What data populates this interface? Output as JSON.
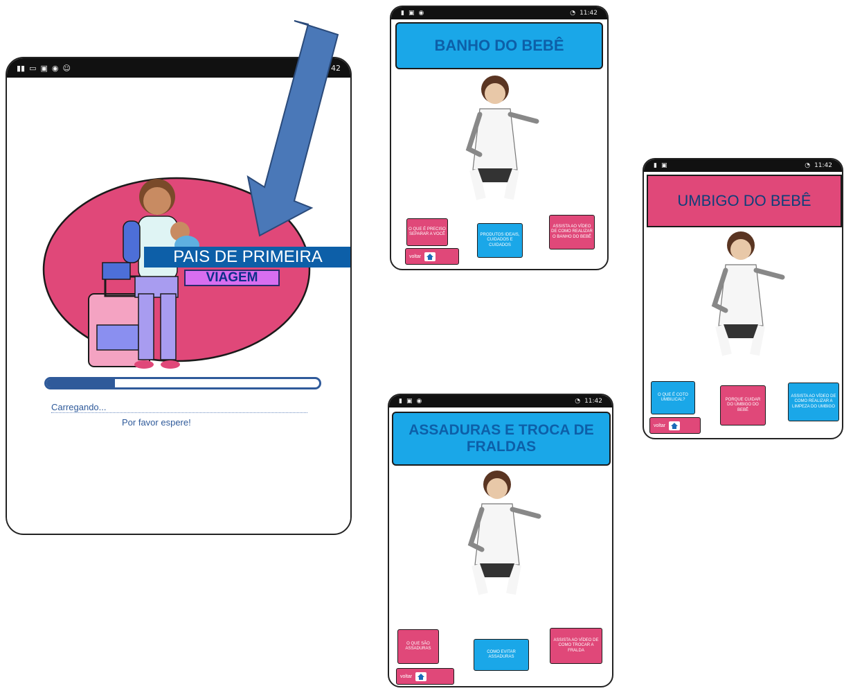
{
  "colors": {
    "accent_blue": "#0d5fa8",
    "banner_blue": "#1aa7e8",
    "pink": "#e04879",
    "arrow": "#4a78b8"
  },
  "loading_screen": {
    "status_time": "42",
    "title_line1": "PAIS DE PRIMEIRA",
    "title_line2": "VIAGEM",
    "progress_fraction": 0.25,
    "loading_text": "Carregando",
    "wait_text": "Por favor espere!"
  },
  "bath_screen": {
    "status_time": "11:42",
    "title": "BANHO DO BEBÊ",
    "bubbles": [
      "O QUE É PRECISO SEPARAR A VOCÊ",
      "PRODUTOS IDEAIS, CUIDADOS E CUIDADOS",
      "ASSISTA AO VÍDEO DE COMO REALIZAR O BANHO DO BEBÊ"
    ],
    "back_label": "voltar"
  },
  "umbilical_screen": {
    "status_time": "11:42",
    "title": "UMBIGO DO BEBÊ",
    "bubbles": [
      "O QUE É COTO UMBILICAL?",
      "PORQUE CUIDAR DO UMBIGO DO BEBÊ",
      "ASSISTA AO VÍDEO DE COMO REALIZAR A LIMPEZA DO UMBIGO"
    ],
    "back_label": "voltar"
  },
  "diaper_screen": {
    "status_time": "11:42",
    "title": "ASSADURAS E TROCA DE FRALDAS",
    "bubbles": [
      "O QUE SÃO ASSADURAS",
      "COMO EVITAR ASSADURAS",
      "ASSISTA AO VÍDEO DE COMO TROCAR A FRALDA"
    ],
    "back_label": "voltar"
  }
}
